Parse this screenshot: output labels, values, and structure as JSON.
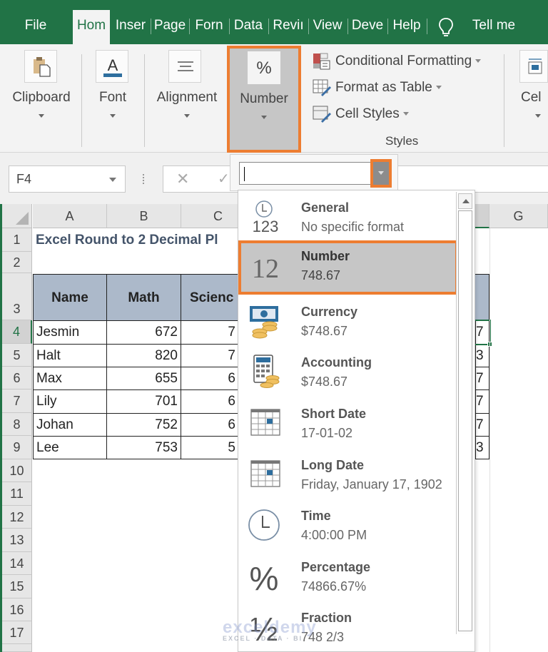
{
  "ribbon_tabs": [
    {
      "label": "File",
      "active": false
    },
    {
      "label": "Hom",
      "active": true
    },
    {
      "label": "Inser",
      "active": false
    },
    {
      "label": "Page",
      "active": false
    },
    {
      "label": "Forn",
      "active": false
    },
    {
      "label": "Data",
      "active": false
    },
    {
      "label": "Reviı",
      "active": false
    },
    {
      "label": "View",
      "active": false
    },
    {
      "label": "Deve",
      "active": false
    },
    {
      "label": "Help",
      "active": false
    }
  ],
  "tell_me": {
    "icon": "lightbulb-icon",
    "label": "Tell me"
  },
  "ribbon_groups": {
    "clipboard": {
      "label": "Clipboard",
      "icon": "clipboard-paste-icon"
    },
    "font": {
      "label": "Font",
      "icon": "font-color-icon"
    },
    "alignment": {
      "label": "Alignment",
      "icon": "align-lines-icon"
    },
    "number": {
      "label": "Number",
      "icon": "percent-icon",
      "highlighted": true
    },
    "styles": {
      "label": "Styles",
      "items": [
        {
          "label": "Conditional Formatting",
          "icon": "conditional-formatting-icon"
        },
        {
          "label": "Format as Table",
          "icon": "format-as-table-icon"
        },
        {
          "label": "Cell Styles",
          "icon": "cell-styles-icon"
        }
      ]
    },
    "cells": {
      "label": "Cel",
      "icon": "cells-insert-icon"
    }
  },
  "formula_bar": {
    "name_box": "F4",
    "cancel_glyph": "✕",
    "enter_glyph": "✓",
    "value": ""
  },
  "number_format_dropdown": {
    "value": "",
    "items": [
      {
        "name": "General",
        "example": "No specific format",
        "icon": "general-123-icon",
        "selected": false
      },
      {
        "name": "Number",
        "example": "748.67",
        "icon": "number-12-icon",
        "selected": true
      },
      {
        "name": "Currency",
        "example": "$748.67",
        "icon": "currency-icon",
        "selected": false
      },
      {
        "name": "Accounting",
        "example": " $748.67",
        "icon": "accounting-icon",
        "selected": false
      },
      {
        "name": "Short Date",
        "example": "17-01-02",
        "icon": "calendar-icon",
        "selected": false
      },
      {
        "name": "Long Date",
        "example": "Friday, January 17, 1902",
        "icon": "calendar-icon",
        "selected": false
      },
      {
        "name": "Time",
        "example": "4:00:00 PM",
        "icon": "clock-icon",
        "selected": false
      },
      {
        "name": "Percentage",
        "example": "74866.67%",
        "icon": "percent-icon",
        "selected": false
      },
      {
        "name": "Fraction",
        "example": "748 2/3",
        "icon": "fraction-icon",
        "selected": false
      }
    ]
  },
  "sheet": {
    "column_headers": [
      "A",
      "B",
      "C",
      "G"
    ],
    "row_headers": [
      "1",
      "2",
      "3",
      "4",
      "5",
      "6",
      "7",
      "8",
      "9",
      "10",
      "11",
      "12",
      "13",
      "14",
      "15",
      "16",
      "17"
    ],
    "title": "Excel Round to 2 Decimal Pl",
    "table_headers": [
      "Name",
      "Math",
      "Scienc"
    ],
    "rows": [
      {
        "name": "Jesmin",
        "math": "672",
        "science": "7",
        "f": "7"
      },
      {
        "name": "Halt",
        "math": "820",
        "science": "7",
        "f": "3"
      },
      {
        "name": "Max",
        "math": "655",
        "science": "6",
        "f": "7"
      },
      {
        "name": "Lily",
        "math": "701",
        "science": "6",
        "f": "7"
      },
      {
        "name": "Johan",
        "math": "752",
        "science": "6",
        "f": "7"
      },
      {
        "name": "Lee",
        "math": "753",
        "science": "5",
        "f": "3"
      }
    ],
    "selected_cell": "F4"
  },
  "watermark": {
    "brand": "exceldemy",
    "tagline": "EXCEL · DATA · BI"
  },
  "colors": {
    "excel_green": "#217346",
    "highlight_orange": "#ed7d31",
    "table_header_fill": "#acb9ca",
    "title_text": "#44546a"
  }
}
